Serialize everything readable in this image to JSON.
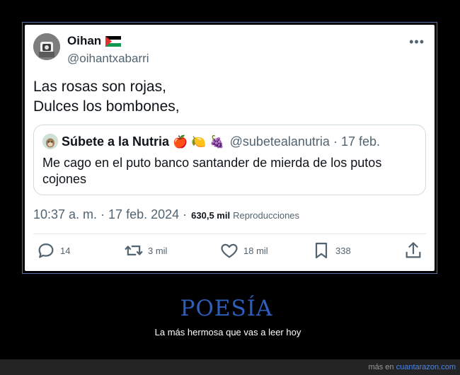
{
  "tweet": {
    "author_name": "Oihan",
    "author_flag": "Palestinian flag",
    "author_handle": "@oihantxabarri",
    "more_label": "•••",
    "body_line1": "Las rosas son rojas,",
    "body_line2": "Dulces los bombones,",
    "quote": {
      "author_name": "Súbete a la Nutria",
      "emojis": [
        "🍎",
        "🍋",
        "🍇"
      ],
      "author_handle": "@subetealanutria",
      "separator": "·",
      "date": "17 feb.",
      "text": "Me cago en el puto banco santander de mierda de los putos cojones"
    },
    "timestamp": "10:37 a. m. · 17 feb. 2024 ·",
    "views_count": "630,5 mil",
    "views_label": "Reproducciones",
    "actions": {
      "replies": {
        "icon": "reply-icon",
        "count": "14"
      },
      "retweets": {
        "icon": "retweet-icon",
        "count": "3 mil"
      },
      "likes": {
        "icon": "heart-icon",
        "count": "18 mil"
      },
      "bookmarks": {
        "icon": "bookmark-icon",
        "count": "338"
      },
      "share": {
        "icon": "share-icon"
      }
    }
  },
  "caption": {
    "title": "POESÍA",
    "subtitle": "La más hermosa que vas a leer hoy"
  },
  "credit": {
    "prefix": "más en",
    "site": "cuantarazon.com"
  },
  "colors": {
    "background": "#000000",
    "tweet_bg": "#ffffff",
    "text_primary": "#0f1419",
    "text_secondary": "#536471",
    "title_blue": "#2e5fbd",
    "link_blue": "#4a86e8",
    "frame_border": "#5a6fa8"
  }
}
